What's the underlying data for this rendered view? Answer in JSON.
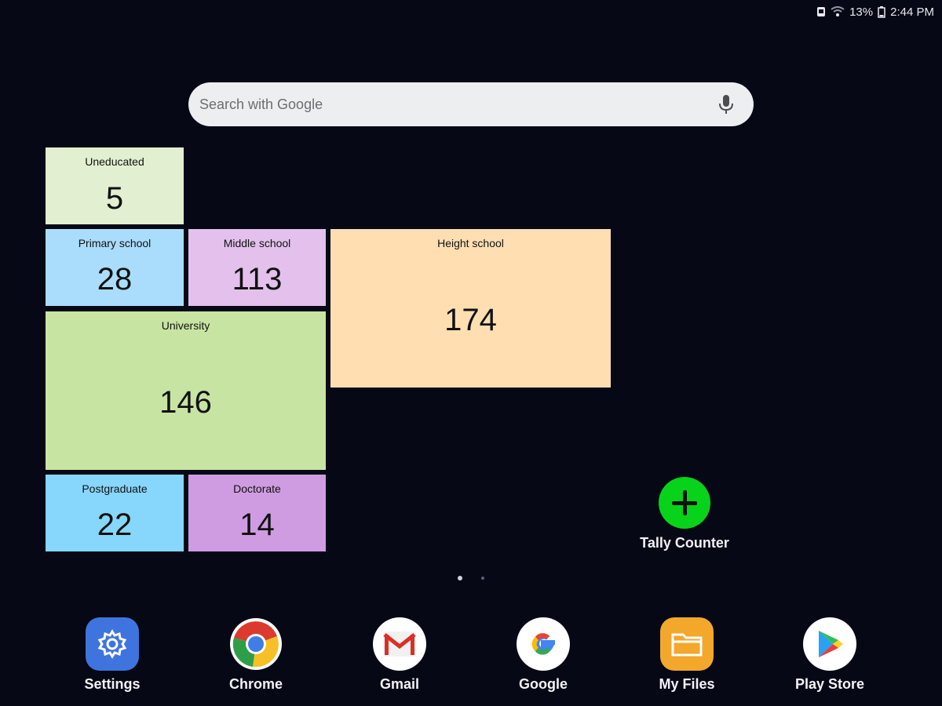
{
  "status_bar": {
    "battery": "13%",
    "time": "2:44 PM"
  },
  "search": {
    "placeholder": "Search with Google"
  },
  "widget": {
    "tiles": [
      {
        "label": "Uneducated",
        "value": 5,
        "color": "#e2efd0"
      },
      {
        "label": "Primary school",
        "value": 28,
        "color": "#a9ddfb"
      },
      {
        "label": "Middle school",
        "value": 113,
        "color": "#e3c1ec"
      },
      {
        "label": "Height school",
        "value": 174,
        "color": "#ffdfb2"
      },
      {
        "label": "University",
        "value": 146,
        "color": "#c8e4a3"
      },
      {
        "label": "Postgraduate",
        "value": 22,
        "color": "#87d6fb"
      },
      {
        "label": "Doctorate",
        "value": 14,
        "color": "#cf9ce1"
      }
    ]
  },
  "tally_counter": {
    "label": "Tally Counter",
    "color": "#07d31a"
  },
  "dock": [
    {
      "label": "Settings",
      "icon": "settings-icon"
    },
    {
      "label": "Chrome",
      "icon": "chrome-icon"
    },
    {
      "label": "Gmail",
      "icon": "gmail-icon"
    },
    {
      "label": "Google",
      "icon": "google-icon"
    },
    {
      "label": "My Files",
      "icon": "my-files-icon"
    },
    {
      "label": "Play Store",
      "icon": "play-store-icon"
    }
  ]
}
